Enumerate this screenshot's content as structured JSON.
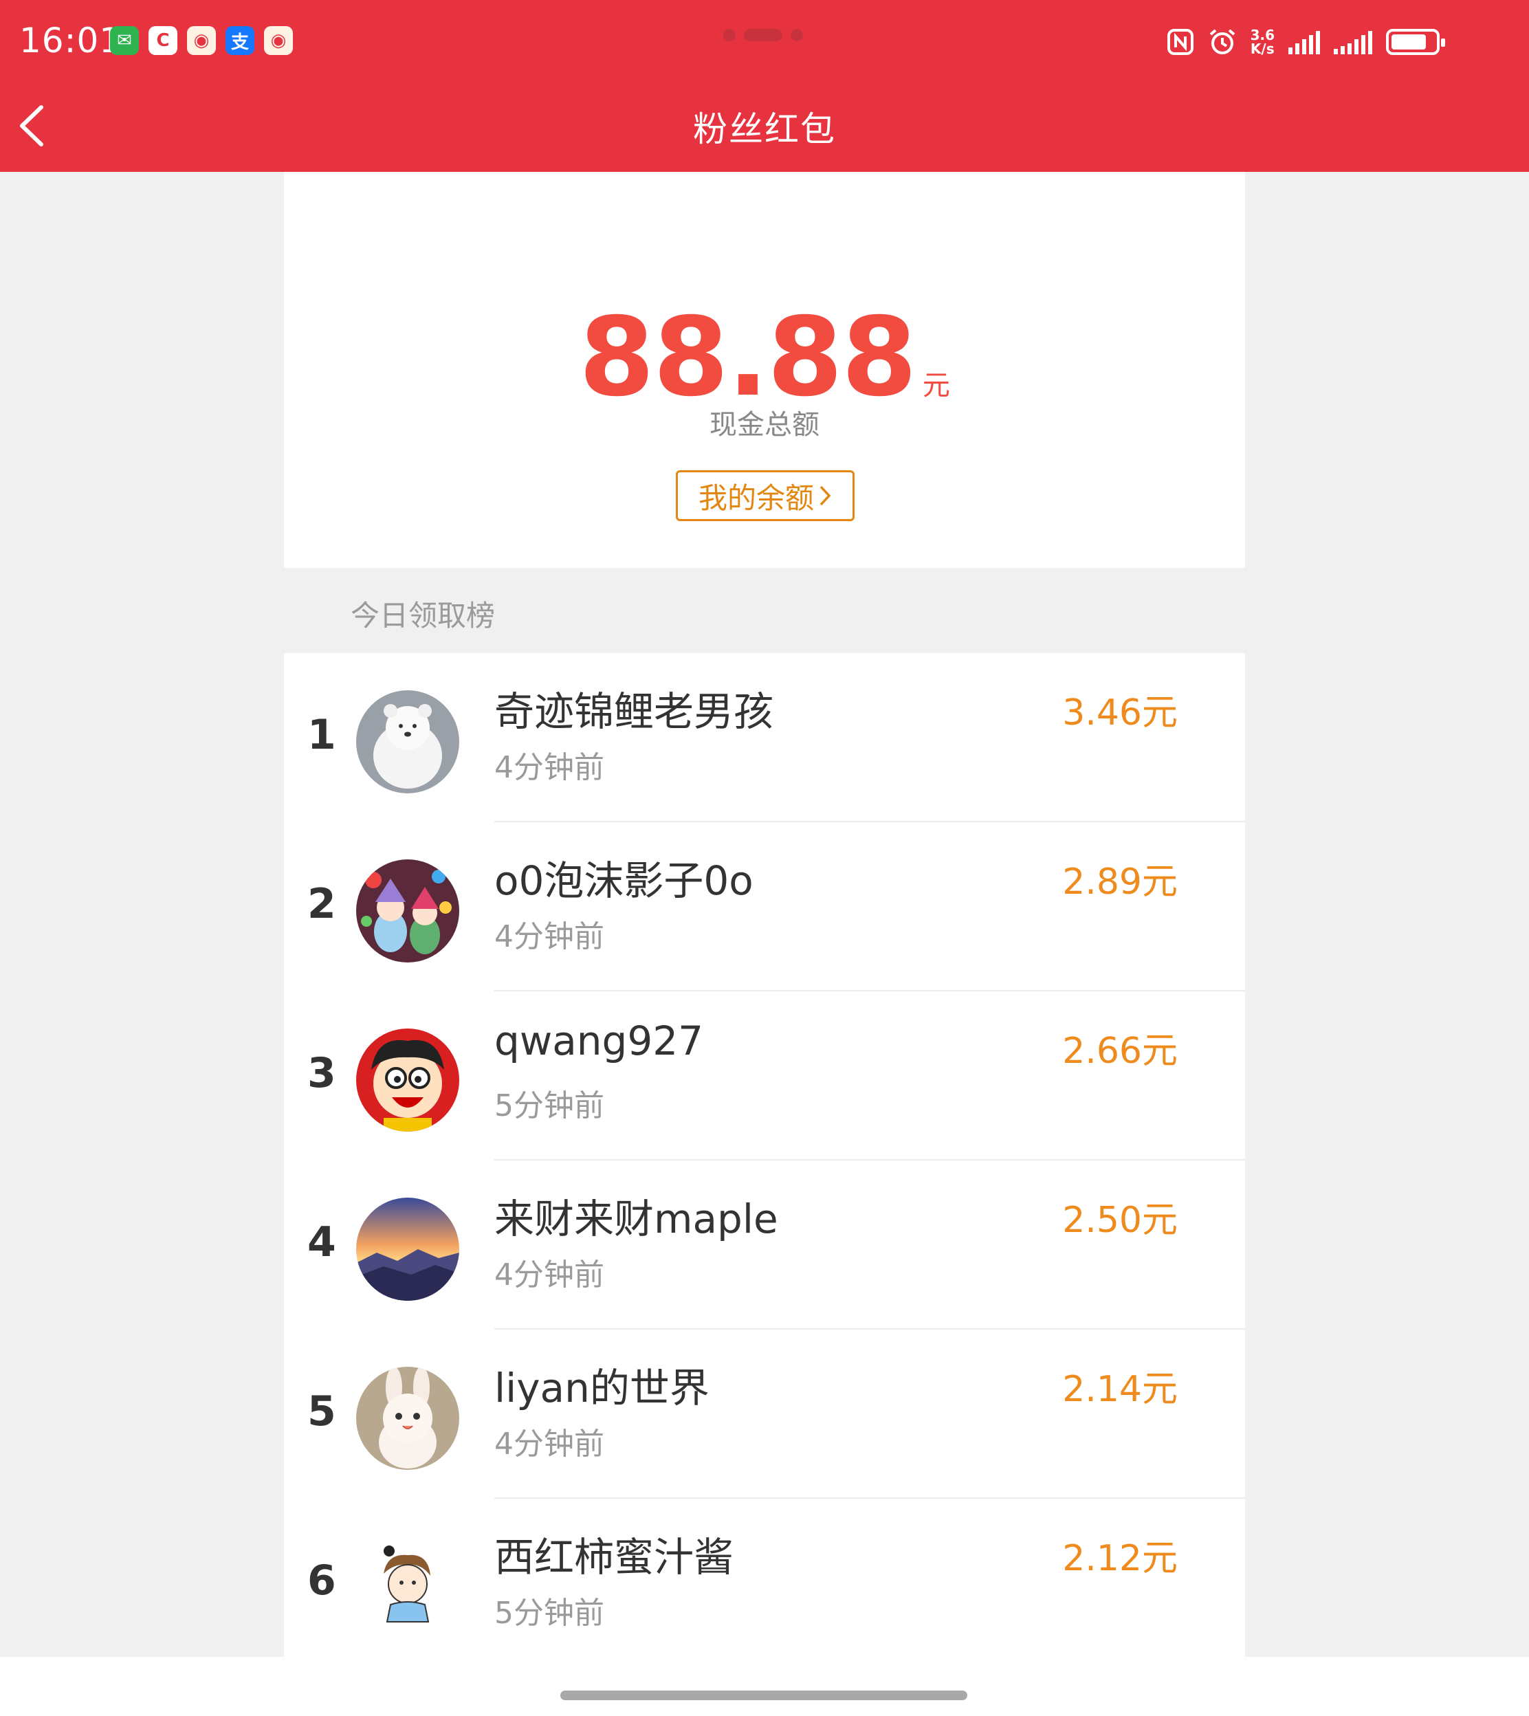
{
  "status_bar": {
    "time": "16:01",
    "apps": [
      {
        "icon": "wechat-icon",
        "glyph": "✉"
      },
      {
        "icon": "c-app-icon",
        "glyph": "C"
      },
      {
        "icon": "weibo-icon",
        "glyph": "◉"
      },
      {
        "icon": "alipay-icon",
        "glyph": "支"
      },
      {
        "icon": "weibo-icon",
        "glyph": "◉"
      }
    ],
    "net_speed_value": "3.6",
    "net_speed_unit": "K/s",
    "battery_level": 0.8
  },
  "header": {
    "title": "粉丝红包",
    "back_icon": "chevron-left-icon",
    "color": "#e6333f"
  },
  "summary": {
    "amount": "88.88",
    "unit": "元",
    "label": "现金总额",
    "balance_button": "我的余额",
    "balance_icon": "chevron-right-icon"
  },
  "leaderboard": {
    "title": "今日领取榜",
    "rows": [
      {
        "rank": "1",
        "name": "奇迹锦鲤老男孩",
        "time": "4分钟前",
        "amount": "3.46元"
      },
      {
        "rank": "2",
        "name": "o0泡沫影子0o",
        "time": "4分钟前",
        "amount": "2.89元"
      },
      {
        "rank": "3",
        "name": "qwang927",
        "time": "5分钟前",
        "amount": "2.66元"
      },
      {
        "rank": "4",
        "name": "来财来财maple",
        "time": "4分钟前",
        "amount": "2.50元"
      },
      {
        "rank": "5",
        "name": "liyan的世界",
        "time": "4分钟前",
        "amount": "2.14元"
      },
      {
        "rank": "6",
        "name": "西红柿蜜汁酱",
        "time": "5分钟前",
        "amount": "2.12元"
      }
    ]
  },
  "colors": {
    "accent_red": "#e6333f",
    "amount_red": "#f24b3f",
    "amount_orange": "#ef8b1d",
    "button_orange": "#e38712"
  }
}
